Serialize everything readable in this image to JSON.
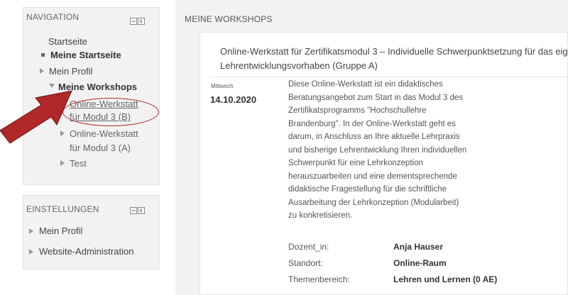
{
  "navigation": {
    "header": "NAVIGATION",
    "items": {
      "startseite": "Startseite",
      "meine_startseite": "Meine Startseite",
      "mein_profil": "Mein Profil",
      "meine_workshops": "Meine Workshops",
      "workshop_b_line1": "Online-Werkstatt",
      "workshop_b_line2": "für Modul 3 (B)",
      "workshop_a_line1": "Online-Werkstatt",
      "workshop_a_line2": "für Modul 3 (A)",
      "test": "Test"
    }
  },
  "settings": {
    "header": "EINSTELLUNGEN",
    "items": {
      "mein_profil": "Mein Profil",
      "website_admin": "Website-Administration"
    }
  },
  "main": {
    "header": "MEINE WORKSHOPS",
    "card": {
      "title": "Online-Werkstatt für Zertifikatsmodul 3 – Individuelle Schwerpunktsetzung für das eige Lehrentwicklungsvorhaben (Gruppe A)",
      "weekday": "Mittwoch",
      "date": "14.10.2020",
      "desc_lines": [
        "Diese Online-Werkstatt ist ein didaktisches",
        "Beratungsangebot zum Start in das Modul 3 des",
        "Zertifikatsprogramms \"Hochschullehre",
        "Brandenburg\". In der Online-Werkstatt geht es",
        "darum, in Anschluss an Ihre aktuelle Lehrpraxis",
        "und bisherige Lehrentwicklung Ihren individuellen",
        "Schwerpunkt für eine Lehrkonzeption",
        "herauszuarbeiten und eine dementsprechende",
        "didaktische Fragestellung für die schriftliche",
        "Ausarbeitung der Lehrkonzeption (Modularbeit)",
        "zu konkretisieren."
      ],
      "details": {
        "dozent_label": "Dozent_in:",
        "dozent_value": "Anja Hauser",
        "standort_label": "Standort:",
        "standort_value": "Online-Raum",
        "themen_label": "Themenbereich:",
        "themen_value": "Lehren und Lernen (0 AE)"
      }
    }
  },
  "colors": {
    "annotation": "#b02828",
    "block_bg": "#f2f2f2"
  },
  "icons": {
    "block_controls": [
      "minimize-icon",
      "dock-icon"
    ],
    "annotation": [
      "red-arrow-icon",
      "red-circle-highlight"
    ]
  }
}
